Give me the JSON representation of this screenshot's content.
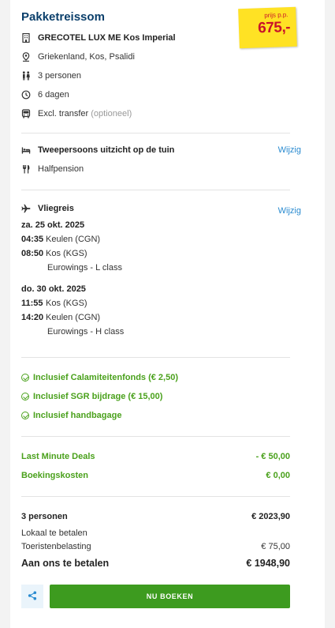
{
  "summary": {
    "title": "Pakketreissom",
    "price_label": "prijs p.p.",
    "price": "675,-"
  },
  "hotel": {
    "name": "GRECOTEL LUX ME Kos Imperial",
    "location": "Griekenland, Kos, Psalidi",
    "persons": "3 personen",
    "duration": "6 dagen",
    "transfer": "Excl. transfer",
    "transfer_note": "(optioneel)"
  },
  "room": {
    "type": "Tweepersoons uitzicht op de tuin",
    "board": "Halfpension",
    "change_label": "Wijzig"
  },
  "flight": {
    "title": "Vliegreis",
    "change_label": "Wijzig",
    "outbound": {
      "date": "za. 25 okt. 2025",
      "dep_time": "04:35",
      "dep_place": "Keulen (CGN)",
      "arr_time": "08:50",
      "arr_place": "Kos (KGS)",
      "carrier": "Eurowings - L class"
    },
    "return": {
      "date": "do. 30 okt. 2025",
      "dep_time": "11:55",
      "dep_place": "Kos (KGS)",
      "arr_time": "14:20",
      "arr_place": "Keulen (CGN)",
      "carrier": "Eurowings - H class"
    }
  },
  "inclusions": [
    "Inclusief Calamiteitenfonds (€ 2,50)",
    "Inclusief SGR bijdrage (€ 15,00)",
    "Inclusief handbagage"
  ],
  "discounts": [
    {
      "label": "Last Minute Deals",
      "value": "- € 50,00"
    },
    {
      "label": "Boekingskosten",
      "value": "€ 0,00"
    }
  ],
  "totals": {
    "persons_label": "3 personen",
    "persons_value": "€ 2023,90",
    "local_label": "Lokaal te betalen",
    "tax_label": "Toeristenbelasting",
    "tax_value": "€ 75,00",
    "pay_label": "Aan ons te betalen",
    "pay_value": "€ 1948,90"
  },
  "actions": {
    "book_label": "NU BOEKEN"
  },
  "colors": {
    "title": "#0b3f6b",
    "price_tag": "#ffe224",
    "price_text": "#c9132a",
    "green": "#4aa11c",
    "book_button": "#3d9b1f",
    "link": "#2a8bd0"
  }
}
